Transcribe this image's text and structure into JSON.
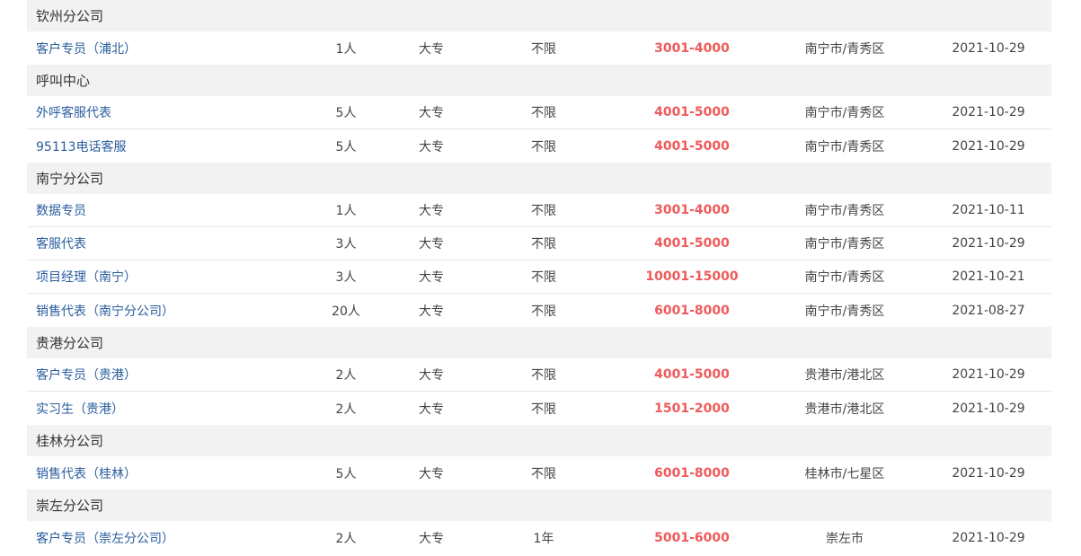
{
  "colors": {
    "link": "#2a5d9e",
    "salary": "#ef5a5a",
    "group_bg": "#f2f2f2"
  },
  "groups": [
    {
      "name": "钦州分公司",
      "jobs": [
        {
          "title": "客户专员（浦北）",
          "count": "1人",
          "education": "大专",
          "experience": "不限",
          "salary": "3001-4000",
          "location": "南宁市/青秀区",
          "date": "2021-10-29"
        }
      ]
    },
    {
      "name": "呼叫中心",
      "jobs": [
        {
          "title": "外呼客服代表",
          "count": "5人",
          "education": "大专",
          "experience": "不限",
          "salary": "4001-5000",
          "location": "南宁市/青秀区",
          "date": "2021-10-29"
        },
        {
          "title": "95113电话客服",
          "count": "5人",
          "education": "大专",
          "experience": "不限",
          "salary": "4001-5000",
          "location": "南宁市/青秀区",
          "date": "2021-10-29"
        }
      ]
    },
    {
      "name": "南宁分公司",
      "jobs": [
        {
          "title": "数据专员",
          "count": "1人",
          "education": "大专",
          "experience": "不限",
          "salary": "3001-4000",
          "location": "南宁市/青秀区",
          "date": "2021-10-11"
        },
        {
          "title": "客服代表",
          "count": "3人",
          "education": "大专",
          "experience": "不限",
          "salary": "4001-5000",
          "location": "南宁市/青秀区",
          "date": "2021-10-29"
        },
        {
          "title": "项目经理（南宁）",
          "count": "3人",
          "education": "大专",
          "experience": "不限",
          "salary": "10001-15000",
          "location": "南宁市/青秀区",
          "date": "2021-10-21"
        },
        {
          "title": "销售代表（南宁分公司）",
          "count": "20人",
          "education": "大专",
          "experience": "不限",
          "salary": "6001-8000",
          "location": "南宁市/青秀区",
          "date": "2021-08-27"
        }
      ]
    },
    {
      "name": "贵港分公司",
      "jobs": [
        {
          "title": "客户专员（贵港）",
          "count": "2人",
          "education": "大专",
          "experience": "不限",
          "salary": "4001-5000",
          "location": "贵港市/港北区",
          "date": "2021-10-29"
        },
        {
          "title": "实习生（贵港）",
          "count": "2人",
          "education": "大专",
          "experience": "不限",
          "salary": "1501-2000",
          "location": "贵港市/港北区",
          "date": "2021-10-29"
        }
      ]
    },
    {
      "name": "桂林分公司",
      "jobs": [
        {
          "title": "销售代表（桂林）",
          "count": "5人",
          "education": "大专",
          "experience": "不限",
          "salary": "6001-8000",
          "location": "桂林市/七星区",
          "date": "2021-10-29"
        }
      ]
    },
    {
      "name": "崇左分公司",
      "jobs": [
        {
          "title": "客户专员（崇左分公司）",
          "count": "2人",
          "education": "大专",
          "experience": "1年",
          "salary": "5001-6000",
          "location": "崇左市",
          "date": "2021-10-29"
        }
      ]
    }
  ]
}
